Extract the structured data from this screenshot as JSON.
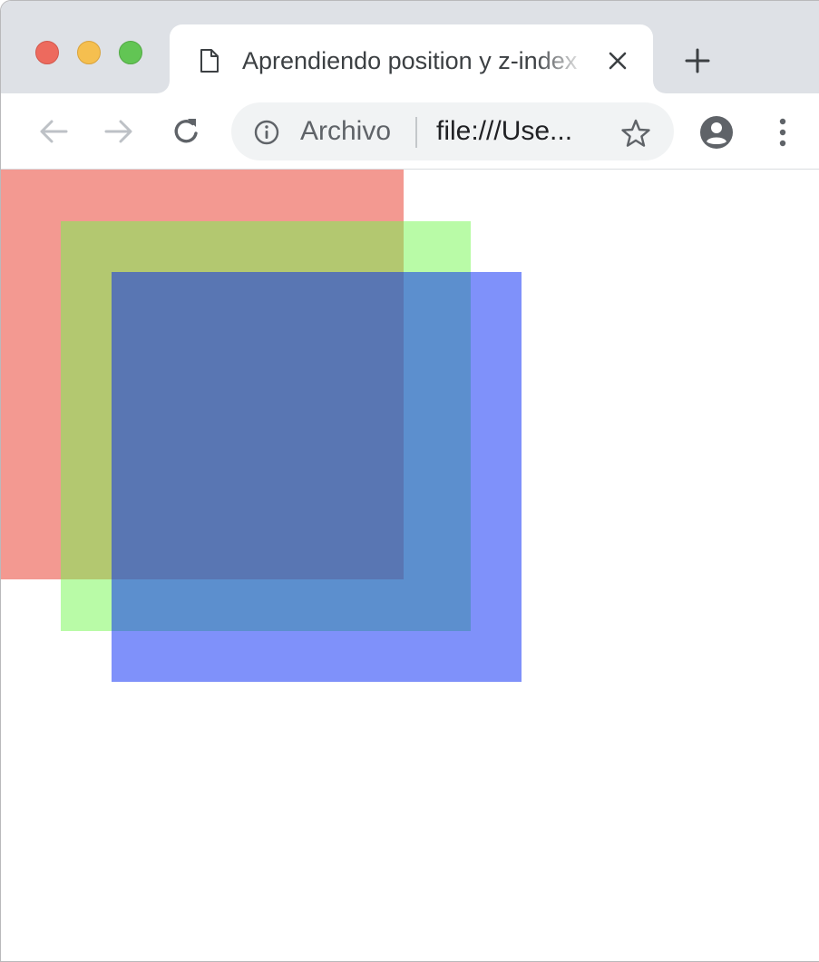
{
  "window": {
    "traffic_lights": [
      "close",
      "minimize",
      "maximize"
    ]
  },
  "tab": {
    "icon": "document-icon",
    "title": "Aprendiendo position y z-index",
    "close_icon": "close-icon"
  },
  "new_tab_icon": "plus-icon",
  "toolbar": {
    "back_icon": "arrow-left-icon",
    "forward_icon": "arrow-right-icon",
    "reload_icon": "reload-icon",
    "omnibox": {
      "info_icon": "info-icon",
      "scheme_label": "Archivo",
      "url": "file:///Use...",
      "star_icon": "star-icon"
    },
    "profile_icon": "account-circle-icon",
    "menu_icon": "more-vertical-icon"
  },
  "page": {
    "boxes": [
      {
        "name": "red-box",
        "color": "#e83323"
      },
      {
        "name": "green-box",
        "color": "#73f74f"
      },
      {
        "name": "blue-box",
        "color": "#0023f5"
      }
    ]
  },
  "colors": {
    "tabstrip_bg": "#dee1e6",
    "omnibox_bg": "#f1f3f4",
    "icon_gray": "#5f6368"
  }
}
